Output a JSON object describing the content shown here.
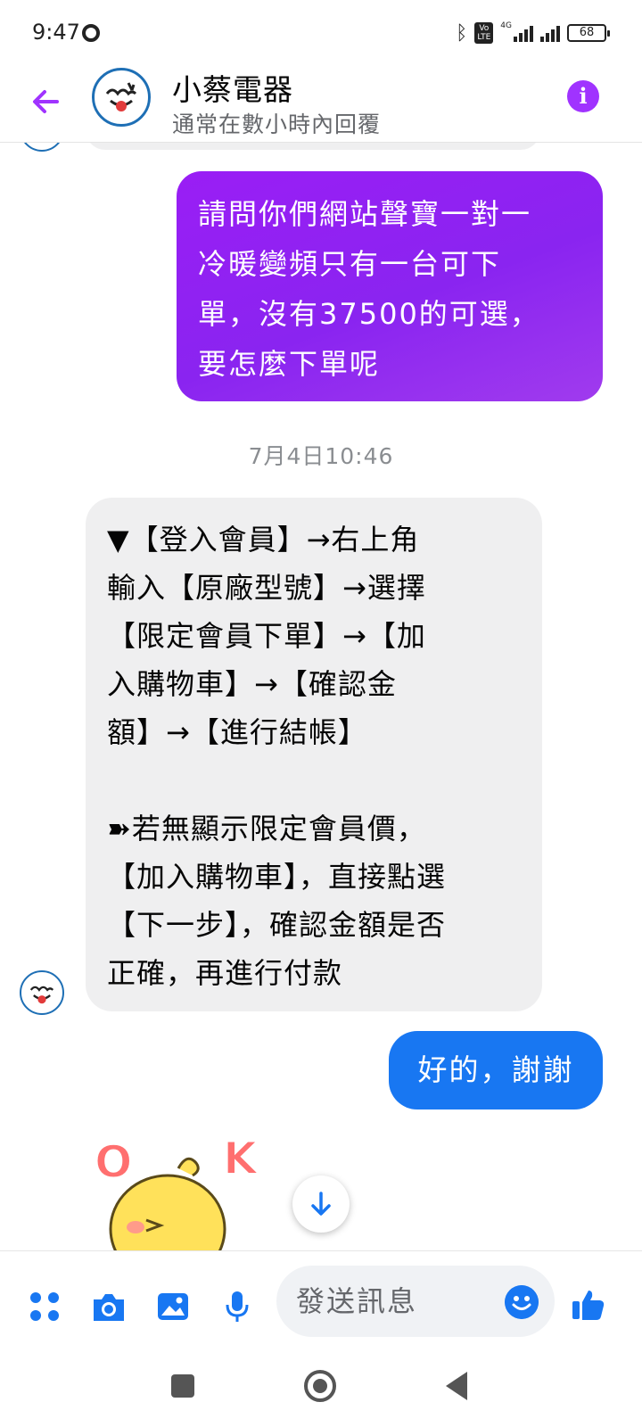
{
  "status_bar": {
    "time": "9:47",
    "network_label": "4G",
    "volte_label": "Vo\nLTE",
    "battery": "68"
  },
  "header": {
    "title": "小蔡電器",
    "subtitle": "通常在數小時內回覆",
    "accent_color": "#a033ff"
  },
  "messages": {
    "outgoing_1": "請問你們網站聲寶一對一\n冷暖變頻只有一台可下\n單，沒有37500的可選，\n要怎麼下單呢",
    "timestamp": "7月4日10:46",
    "incoming_1": "▼【登入會員】→右上角\n輸入【原廠型號】→選擇\n【限定會員下單】→【加\n入購物車】→【確認金\n額】→【進行結帳】\n\n➽若無顯示限定會員價，\n【加入購物車】，直接點選\n【下一步】，確認金額是否\n正確，再進行付款",
    "outgoing_2": "好的，謝謝",
    "outgoing_2_color": "#1877f2"
  },
  "composer": {
    "placeholder": "發送訊息",
    "icons": [
      "menu-dots-icon",
      "camera-icon",
      "gallery-icon",
      "microphone-icon",
      "emoji-icon",
      "thumbs-up-icon"
    ]
  },
  "sticker": {
    "text": "OK"
  }
}
